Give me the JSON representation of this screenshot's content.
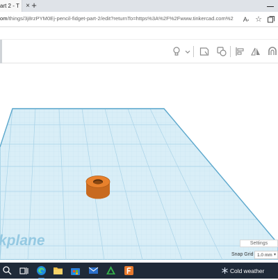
{
  "browser": {
    "tab_title": "art 2 - T",
    "tab_close": "×",
    "new_tab": "+",
    "url_host": "om",
    "url_path": "/things/3j8rzPYM0Ej-pencil-fidget-part-2/edit?returnTo=https%3A%2F%2Fwww.tinkercad.com%2Fdash...",
    "read_aloud": "A",
    "favorite": "☆"
  },
  "viewport": {
    "workplane_label": "kplane",
    "settings_label": "Settings",
    "snap_grid_label": "Snap Grid",
    "snap_grid_value": "1.0 mm"
  },
  "taskbar": {
    "weather_text": "Cold weather"
  },
  "colors": {
    "workplane_fill": "#d9eef7",
    "workplane_grid": "#a9d3e8",
    "object": "#e8812c",
    "taskbar": "#1f2a38"
  }
}
